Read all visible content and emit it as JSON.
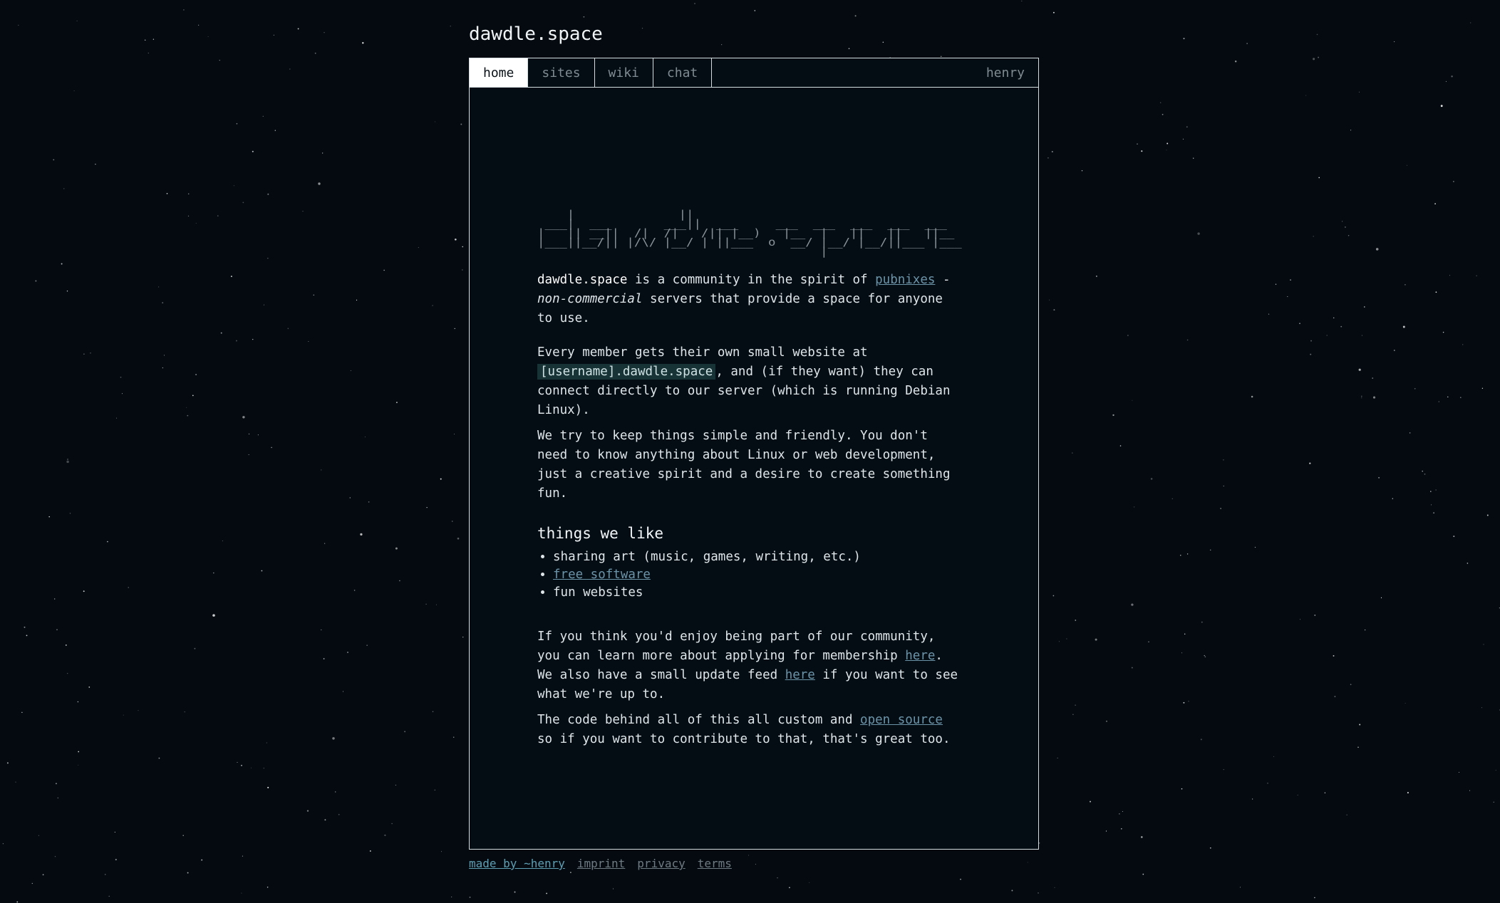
{
  "site": {
    "title": "dawdle.space"
  },
  "tabs": [
    {
      "label": "home",
      "active": true
    },
    {
      "label": "sites",
      "active": false
    },
    {
      "label": "wiki",
      "active": false
    },
    {
      "label": "chat",
      "active": false
    }
  ],
  "user": {
    "name": "henry"
  },
  "intro": {
    "brand": "dawdle.space",
    "text1": " is a community in the spirit of ",
    "link_pubnixes": "pubnixes",
    "text2": " - ",
    "emphasis": "non-commercial",
    "text3": " servers that provide a space for anyone to use."
  },
  "website": {
    "text1": "Every member gets their own small website at ",
    "code": "[username].dawdle.space",
    "text2": ", and (if they want) they can connect directly to our server (which is running Debian Linux)."
  },
  "simple": {
    "text": "We try to keep things simple and friendly. You don't need to know anything about Linux or web development, just a creative spirit and a desire to create something fun."
  },
  "likes": {
    "heading": "things we like",
    "item1": "sharing art (music, games, writing, etc.)",
    "item2_link": "free software",
    "item3": "fun websites"
  },
  "join": {
    "text1": "If you think you'd enjoy being part of our community, you can learn more about applying for membership ",
    "link1": "here",
    "text2": ". We also have a small update feed ",
    "link2": "here",
    "text3": " if you want to see what we're up to."
  },
  "code_para": {
    "text1": "The code behind all of this all custom and ",
    "link": "open source",
    "text2": " so if you want to contribute to that, that's great too."
  },
  "footer": {
    "credit": "made by ~henry",
    "imprint": "imprint",
    "privacy": "privacy",
    "terms": "terms"
  },
  "colors": {
    "background": "#040a10",
    "panel": "#050d14",
    "link": "#6c94a9",
    "credit_link": "#5e9fb3",
    "code_bg": "#173336"
  }
}
